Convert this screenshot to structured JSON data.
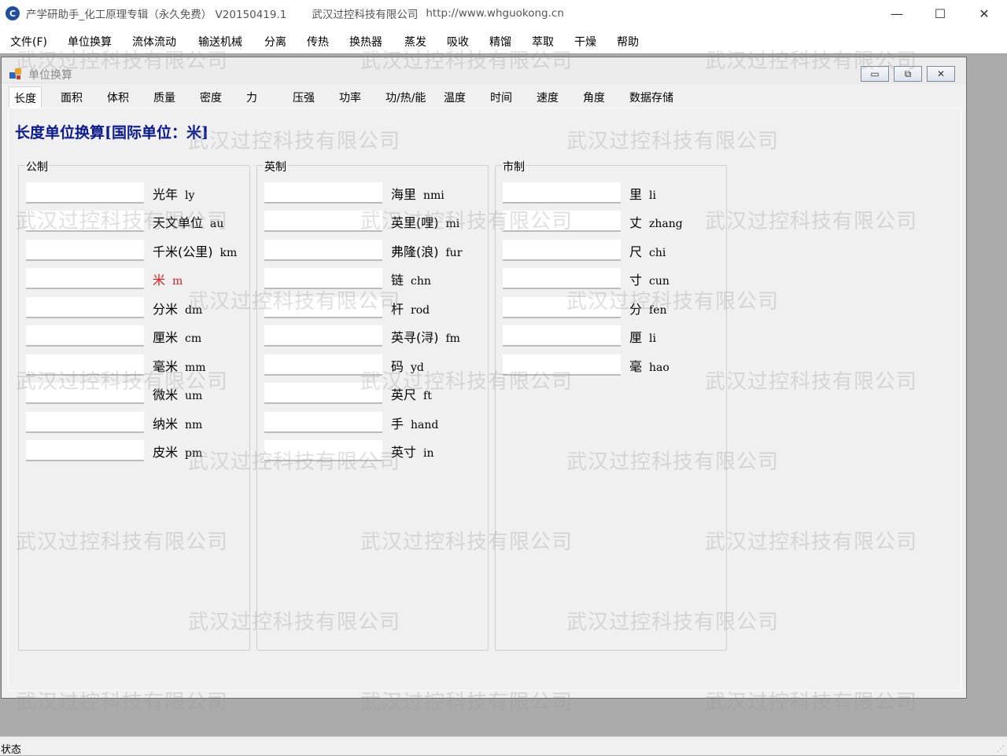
{
  "titlebar": {
    "icon_glyph": "C",
    "title": "产学研助手_化工原理专辑（永久免费） V20150419.1",
    "company": "武汉过控科技有限公司",
    "url": "http://www.whguokong.cn",
    "minimize_glyph": "—",
    "maximize_glyph": "☐",
    "close_glyph": "✕"
  },
  "menu": [
    "文件(F)",
    "单位换算",
    "流体流动",
    "输送机械",
    "分离",
    "传热",
    "换热器",
    "蒸发",
    "吸收",
    "精馏",
    "萃取",
    "干燥",
    "帮助"
  ],
  "child": {
    "title": "单位换算",
    "minimize_glyph": "▭",
    "restore_glyph": "⧉",
    "close_glyph": "✕"
  },
  "tabs": [
    "长度",
    "面积",
    "体积",
    "质量",
    "密度",
    "力",
    "压强",
    "功率",
    "功/热/能",
    "温度",
    "时间",
    "速度",
    "角度",
    "数据存储"
  ],
  "active_tab": "长度",
  "heading": "长度单位换算[国际单位：米]",
  "groups": {
    "metric": {
      "title": "公制",
      "rows": [
        {
          "name": "光年",
          "abbr": "ly"
        },
        {
          "name": "天文单位",
          "abbr": "au"
        },
        {
          "name": "千米(公里)",
          "abbr": "km"
        },
        {
          "name": "米",
          "abbr": "m"
        },
        {
          "name": "分米",
          "abbr": "dm"
        },
        {
          "name": "厘米",
          "abbr": "cm"
        },
        {
          "name": "毫米",
          "abbr": "mm"
        },
        {
          "name": "微米",
          "abbr": "um"
        },
        {
          "name": "纳米",
          "abbr": "nm"
        },
        {
          "name": "皮米",
          "abbr": "pm"
        }
      ]
    },
    "imperial": {
      "title": "英制",
      "rows": [
        {
          "name": "海里",
          "abbr": "nmi"
        },
        {
          "name": "英里(哩)",
          "abbr": "mi"
        },
        {
          "name": "弗隆(浪)",
          "abbr": "fur"
        },
        {
          "name": "链",
          "abbr": "chn"
        },
        {
          "name": "杆",
          "abbr": "rod"
        },
        {
          "name": "英寻(浔)",
          "abbr": "fm"
        },
        {
          "name": "码",
          "abbr": "yd"
        },
        {
          "name": "英尺",
          "abbr": "ft"
        },
        {
          "name": "手",
          "abbr": "hand"
        },
        {
          "name": "英寸",
          "abbr": "in"
        }
      ]
    },
    "chinese": {
      "title": "市制",
      "rows": [
        {
          "name": "里",
          "abbr": "li"
        },
        {
          "name": "丈",
          "abbr": "zhang"
        },
        {
          "name": "尺",
          "abbr": "chi"
        },
        {
          "name": "寸",
          "abbr": "cun"
        },
        {
          "name": "分",
          "abbr": "fen"
        },
        {
          "name": "厘",
          "abbr": "li"
        },
        {
          "name": "毫",
          "abbr": "hao"
        }
      ]
    }
  },
  "watermark": "武汉过控科技有限公司",
  "status": {
    "text": "状态",
    "grip": "⋰"
  },
  "colors": {
    "heading": "#0b1a8c",
    "highlight": "#d42222"
  }
}
